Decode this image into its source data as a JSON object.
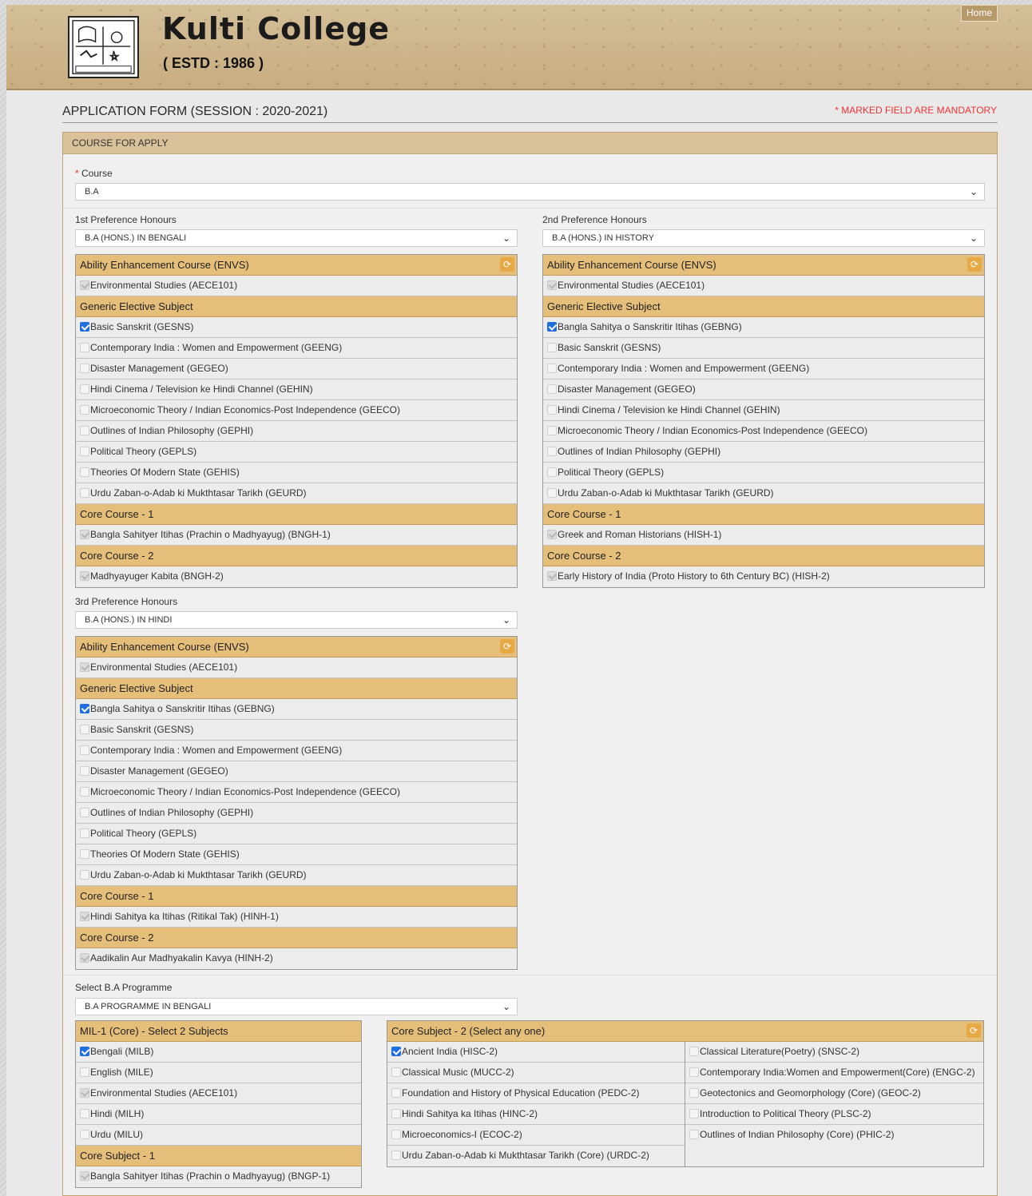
{
  "header": {
    "college_name": "Kulti College",
    "estd": "( ESTD : 1986 )",
    "home_label": "Home"
  },
  "form": {
    "title": "APPLICATION FORM (SESSION : 2020-2021)",
    "mandatory_note": "* MARKED FIELD ARE MANDATORY",
    "panel_title": "COURSE FOR APPLY",
    "course_label": "Course",
    "course_value": "B.A",
    "pref1_label": "1st Preference Honours",
    "pref1_value": "B.A (HONS.) IN BENGALI",
    "pref2_label": "2nd Preference Honours",
    "pref2_value": "B.A (HONS.) IN HISTORY",
    "pref3_label": "3rd Preference Honours",
    "pref3_value": "B.A (HONS.) IN HINDI",
    "prog_label": "Select B.A Programme",
    "prog_value": "B.A PROGRAMME IN BENGALI"
  },
  "pref1": {
    "groups": [
      {
        "title": "Ability Enhancement Course (ENVS)",
        "items": [
          {
            "label": "Environmental Studies (AECE101)",
            "state": "disabled"
          }
        ]
      },
      {
        "title": "Generic Elective Subject",
        "items": [
          {
            "label": "Basic Sanskrit (GESNS)",
            "state": "checked"
          },
          {
            "label": "Contemporary India : Women and Empowerment (GEENG)",
            "state": "unchecked"
          },
          {
            "label": "Disaster Management (GEGEO)",
            "state": "unchecked"
          },
          {
            "label": "Hindi Cinema / Television ke Hindi Channel (GEHIN)",
            "state": "unchecked"
          },
          {
            "label": "Microeconomic Theory / Indian Economics-Post Independence (GEECO)",
            "state": "unchecked"
          },
          {
            "label": "Outlines of Indian Philosophy (GEPHI)",
            "state": "unchecked"
          },
          {
            "label": "Political Theory (GEPLS)",
            "state": "unchecked"
          },
          {
            "label": "Theories Of Modern State (GEHIS)",
            "state": "unchecked"
          },
          {
            "label": "Urdu Zaban-o-Adab ki Mukthtasar Tarikh (GEURD)",
            "state": "unchecked"
          }
        ]
      },
      {
        "title": "Core Course - 1",
        "items": [
          {
            "label": "Bangla Sahityer Itihas (Prachin o Madhyayug) (BNGH-1)",
            "state": "disabled"
          }
        ]
      },
      {
        "title": "Core Course - 2",
        "items": [
          {
            "label": "Madhyayuger Kabita (BNGH-2)",
            "state": "disabled"
          }
        ]
      }
    ]
  },
  "pref2": {
    "groups": [
      {
        "title": "Ability Enhancement Course (ENVS)",
        "items": [
          {
            "label": "Environmental Studies (AECE101)",
            "state": "disabled"
          }
        ]
      },
      {
        "title": "Generic Elective Subject",
        "items": [
          {
            "label": "Bangla Sahitya o Sanskritir Itihas (GEBNG)",
            "state": "checked"
          },
          {
            "label": "Basic Sanskrit (GESNS)",
            "state": "unchecked"
          },
          {
            "label": "Contemporary India : Women and Empowerment (GEENG)",
            "state": "unchecked"
          },
          {
            "label": "Disaster Management (GEGEO)",
            "state": "unchecked"
          },
          {
            "label": "Hindi Cinema / Television ke Hindi Channel (GEHIN)",
            "state": "unchecked"
          },
          {
            "label": "Microeconomic Theory / Indian Economics-Post Independence (GEECO)",
            "state": "unchecked"
          },
          {
            "label": "Outlines of Indian Philosophy (GEPHI)",
            "state": "unchecked"
          },
          {
            "label": "Political Theory (GEPLS)",
            "state": "unchecked"
          },
          {
            "label": "Urdu Zaban-o-Adab ki Mukthtasar Tarikh (GEURD)",
            "state": "unchecked"
          }
        ]
      },
      {
        "title": "Core Course - 1",
        "items": [
          {
            "label": "Greek and Roman Historians (HISH-1)",
            "state": "disabled"
          }
        ]
      },
      {
        "title": "Core Course - 2",
        "items": [
          {
            "label": "Early History of India (Proto History to 6th Century BC) (HISH-2)",
            "state": "disabled"
          }
        ]
      }
    ]
  },
  "pref3": {
    "groups": [
      {
        "title": "Ability Enhancement Course (ENVS)",
        "items": [
          {
            "label": "Environmental Studies (AECE101)",
            "state": "disabled"
          }
        ]
      },
      {
        "title": "Generic Elective Subject",
        "items": [
          {
            "label": "Bangla Sahitya o Sanskritir Itihas (GEBNG)",
            "state": "checked"
          },
          {
            "label": "Basic Sanskrit (GESNS)",
            "state": "unchecked"
          },
          {
            "label": "Contemporary India : Women and Empowerment (GEENG)",
            "state": "unchecked"
          },
          {
            "label": "Disaster Management (GEGEO)",
            "state": "unchecked"
          },
          {
            "label": "Microeconomic Theory / Indian Economics-Post Independence (GEECO)",
            "state": "unchecked"
          },
          {
            "label": "Outlines of Indian Philosophy (GEPHI)",
            "state": "unchecked"
          },
          {
            "label": "Political Theory (GEPLS)",
            "state": "unchecked"
          },
          {
            "label": "Theories Of Modern State (GEHIS)",
            "state": "unchecked"
          },
          {
            "label": "Urdu Zaban-o-Adab ki Mukthtasar Tarikh (GEURD)",
            "state": "unchecked"
          }
        ]
      },
      {
        "title": "Core Course - 1",
        "items": [
          {
            "label": "Hindi Sahitya ka Itihas (Ritikal Tak) (HINH-1)",
            "state": "disabled"
          }
        ]
      },
      {
        "title": "Core Course - 2",
        "items": [
          {
            "label": "Aadikalin Aur Madhyakalin Kavya (HINH-2)",
            "state": "disabled"
          }
        ]
      }
    ]
  },
  "mil": {
    "groups": [
      {
        "title": "MIL-1 (Core) - Select 2 Subjects",
        "items": [
          {
            "label": "Bengali (MILB)",
            "state": "checked"
          },
          {
            "label": "English (MILE)",
            "state": "unchecked"
          },
          {
            "label": "Environmental Studies (AECE101)",
            "state": "disabled"
          },
          {
            "label": "Hindi (MILH)",
            "state": "unchecked"
          },
          {
            "label": "Urdu (MILU)",
            "state": "unchecked"
          }
        ]
      },
      {
        "title": "Core Subject - 1",
        "items": [
          {
            "label": "Bangla Sahityer Itihas (Prachin o Madhyayug) (BNGP-1)",
            "state": "disabled"
          }
        ]
      }
    ]
  },
  "core2": {
    "title": "Core Subject - 2 (Select any one)",
    "left": [
      {
        "label": "Ancient India (HISC-2)",
        "state": "checked"
      },
      {
        "label": "Classical Music (MUCC-2)",
        "state": "unchecked"
      },
      {
        "label": "Foundation and History of Physical Education (PEDC-2)",
        "state": "unchecked"
      },
      {
        "label": "Hindi Sahitya ka Itihas (HINC-2)",
        "state": "unchecked"
      },
      {
        "label": "Microeconomics-I (ECOC-2)",
        "state": "unchecked"
      },
      {
        "label": "Urdu Zaban-o-Adab ki Mukthtasar Tarikh (Core) (URDC-2)",
        "state": "unchecked"
      }
    ],
    "right": [
      {
        "label": "Classical Literature(Poetry) (SNSC-2)",
        "state": "unchecked"
      },
      {
        "label": "Contemporary India:Women and Empowerment(Core) (ENGC-2)",
        "state": "unchecked"
      },
      {
        "label": "Geotectonics and Geomorphology (Core) (GEOC-2)",
        "state": "unchecked"
      },
      {
        "label": "Introduction to Political Theory (PLSC-2)",
        "state": "unchecked"
      },
      {
        "label": "Outlines of Indian Philosophy (Core) (PHIC-2)",
        "state": "unchecked"
      }
    ]
  },
  "icons": {
    "refresh": "refresh-icon",
    "chevron": "chevron-down-icon",
    "logo": "college-logo"
  },
  "colors": {
    "header_bg": "#cdb58c",
    "group_head": "#e5bf7a",
    "checked": "#1f6fe0",
    "mandatory": "#ee3333"
  }
}
